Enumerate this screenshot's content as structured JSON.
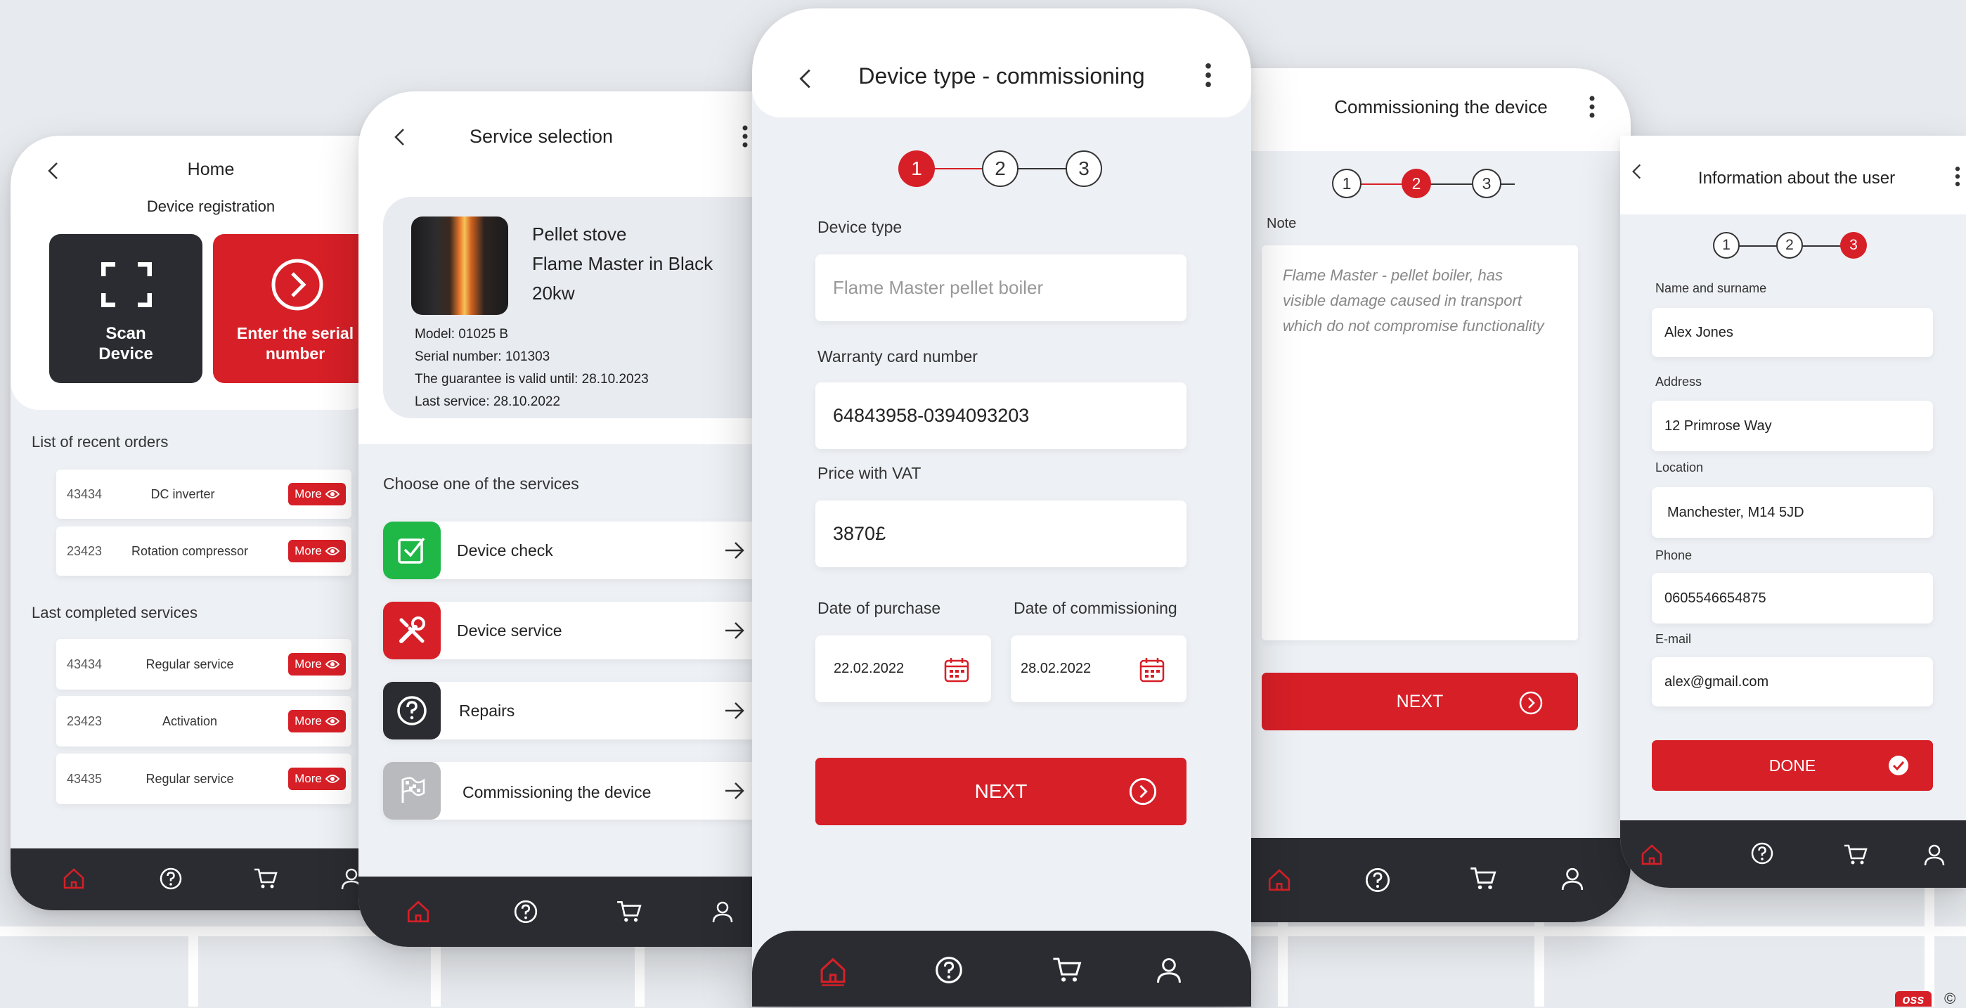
{
  "colors": {
    "accent": "#d71f27",
    "dark": "#2b2c31",
    "green": "#1fb847",
    "gray": "#b9babd"
  },
  "home": {
    "title": "Home",
    "section": "Device registration",
    "scan_label_1": "Scan",
    "scan_label_2": "Device",
    "serial_label_1": "Enter the serial",
    "serial_label_2": "number",
    "recent_title": "List of recent orders",
    "recent_orders": [
      {
        "id": "43434",
        "name": "DC inverter",
        "more": "More"
      },
      {
        "id": "23423",
        "name": "Rotation compressor",
        "more": "More"
      }
    ],
    "completed_title": "Last completed services",
    "completed_services": [
      {
        "id": "43434",
        "name": "Regular service",
        "more": "More"
      },
      {
        "id": "23423",
        "name": "Activation",
        "more": "More"
      },
      {
        "id": "43435",
        "name": "Regular service",
        "more": "More"
      }
    ]
  },
  "service": {
    "title": "Service selection",
    "product_line1": "Pellet stove",
    "product_line2": "Flame Master in Black",
    "product_line3": "20kw",
    "model": "Model: 01025 B",
    "serial": "Serial number: 101303",
    "guarantee": "The guarantee is valid until: 28.10.2023",
    "last_service": "Last service: 28.10.2022",
    "choose": "Choose one of the services",
    "items": [
      {
        "label": "Device check",
        "icon": "checkbox-icon"
      },
      {
        "label": "Device service",
        "icon": "tools-icon"
      },
      {
        "label": "Repairs",
        "icon": "question-icon"
      },
      {
        "label": "Commissioning the device",
        "icon": "flag-icon"
      }
    ]
  },
  "commission": {
    "title": "Device type - commissioning",
    "steps": [
      "1",
      "2",
      "3"
    ],
    "device_type_label": "Device type",
    "device_type_placeholder": "Flame Master pellet boiler",
    "warranty_label": "Warranty card number",
    "warranty_value": "64843958-0394093203",
    "price_label": "Price with VAT",
    "price_value": "3870£",
    "purchase_label": "Date of purchase",
    "purchase_value": "22.02.2022",
    "commissioning_label": "Date of commissioning",
    "commissioning_value": "28.02.2022",
    "next": "NEXT"
  },
  "note_screen": {
    "title": "Commissioning the device",
    "steps": [
      "1",
      "2",
      "3"
    ],
    "note_label": "Note",
    "note_line1": "Flame Master - pellet boiler, has",
    "note_line2": "visible damage caused in transport",
    "note_line3": "which do not compromise functionality",
    "next": "NEXT"
  },
  "user": {
    "title": "Information about the user",
    "steps": [
      "1",
      "2",
      "3"
    ],
    "name_label": "Name and surname",
    "name_value": "Alex Jones",
    "address_label": "Address",
    "address_value": "12 Primrose Way",
    "location_label": "Location",
    "location_value": "Manchester, M14 5JD",
    "phone_label": "Phone",
    "phone_value": "0605546654875",
    "email_label": "E-mail",
    "email_value": "alex@gmail.com",
    "done": "DONE"
  },
  "corner_badge": "oss",
  "corner_mark": "©"
}
